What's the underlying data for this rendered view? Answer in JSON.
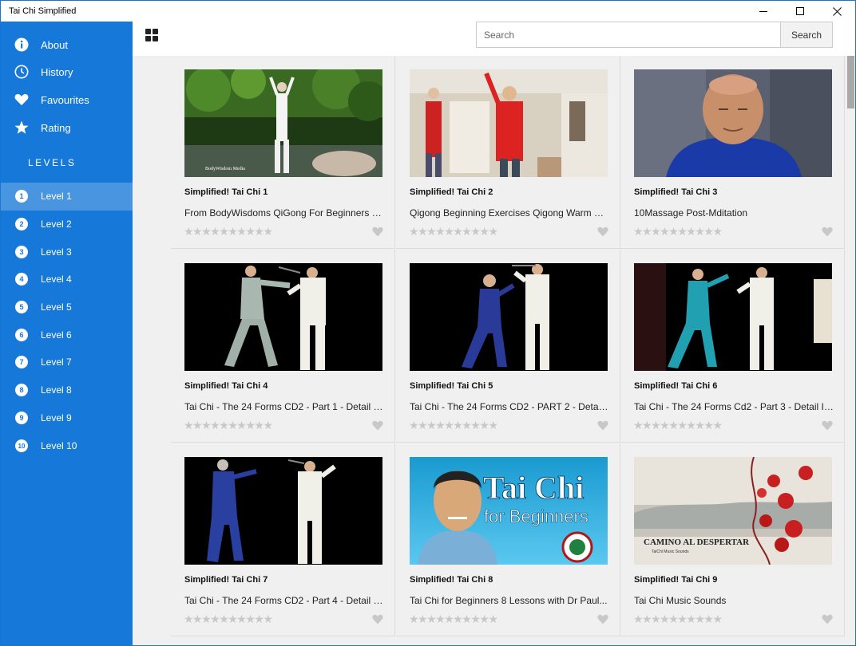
{
  "window": {
    "title": "Tai Chi Simplified"
  },
  "sidebar": {
    "nav": [
      {
        "label": "About",
        "icon": "info-icon"
      },
      {
        "label": "History",
        "icon": "clock-icon"
      },
      {
        "label": "Favourites",
        "icon": "heart-icon"
      },
      {
        "label": "Rating",
        "icon": "star-icon"
      }
    ],
    "levels_title": "LEVELS",
    "levels": [
      {
        "num": "1",
        "label": "Level 1",
        "active": true
      },
      {
        "num": "2",
        "label": "Level 2"
      },
      {
        "num": "3",
        "label": "Level 3"
      },
      {
        "num": "4",
        "label": "Level 4"
      },
      {
        "num": "5",
        "label": "Level 5"
      },
      {
        "num": "6",
        "label": "Level 6"
      },
      {
        "num": "7",
        "label": "Level 7"
      },
      {
        "num": "8",
        "label": "Level 8"
      },
      {
        "num": "9",
        "label": "Level 9"
      },
      {
        "num": "10",
        "label": "Level 10"
      }
    ]
  },
  "search": {
    "placeholder": "Search",
    "button_label": "Search"
  },
  "cards": [
    {
      "title": "Simplified! Tai Chi 1",
      "desc": "From BodyWisdoms QiGong For Beginners wi...",
      "thumb_caption": "BodyWisdom Media",
      "rating": 0,
      "favourite": false
    },
    {
      "title": "Simplified! Tai Chi 2",
      "desc": "Qigong Beginning Exercises Qigong Warm Ups",
      "rating": 0,
      "favourite": false
    },
    {
      "title": "Simplified! Tai Chi 3",
      "desc": "10Massage Post-Mditation",
      "rating": 0,
      "favourite": false
    },
    {
      "title": "Simplified! Tai Chi 4",
      "desc": "Tai Chi - The 24 Forms CD2 - Part 1 - Detail In...",
      "rating": 0,
      "favourite": false
    },
    {
      "title": "Simplified! Tai Chi 5",
      "desc": "Tai Chi - The 24 Forms CD2 - PART 2 - Detail...",
      "rating": 0,
      "favourite": false
    },
    {
      "title": "Simplified! Tai Chi 6",
      "desc": "Tai Chi - The 24 Forms Cd2 - Part 3 - Detail In...",
      "rating": 0,
      "favourite": false
    },
    {
      "title": "Simplified! Tai Chi 7",
      "desc": "Tai Chi - The 24 Forms CD2 - Part 4 - Detail In...",
      "rating": 0,
      "favourite": false
    },
    {
      "title": "Simplified! Tai Chi 8",
      "desc": "Tai Chi for Beginners 8 Lessons with Dr Paul...",
      "thumb_line1": "Tai Chi",
      "thumb_line2": "for Beginners",
      "rating": 0,
      "favourite": false
    },
    {
      "title": "Simplified! Tai Chi 9",
      "desc": "Tai Chi Music Sounds",
      "thumb_line1": "CAMINO AL DESPERTAR",
      "thumb_line2": "TaiChi Music Sounds",
      "rating": 0,
      "favourite": false
    }
  ],
  "stars_max": 10,
  "colors": {
    "sidebar": "#1678d8",
    "active_level": "#4a95e0",
    "content_bg": "#f0f0f0",
    "star_empty": "#c8c8c8"
  }
}
